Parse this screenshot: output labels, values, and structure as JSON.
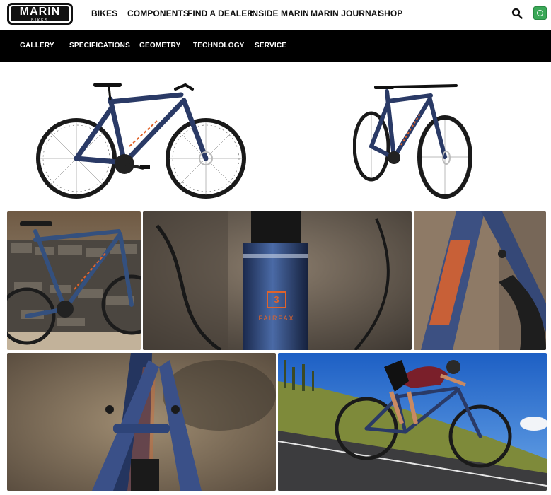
{
  "logo": {
    "word": "MARIN",
    "sub": "BIKES"
  },
  "topnav": {
    "items": [
      "BIKES",
      "COMPONENTS",
      "FIND A DEALER",
      "INSIDE MARIN",
      "MARIN JOURNAL",
      "SHOP"
    ]
  },
  "icons": {
    "search": "search-icon",
    "region": "globe-icon"
  },
  "subnav": {
    "items": [
      "GALLERY",
      "SPECIFICATIONS",
      "GEOMETRY",
      "TECHNOLOGY",
      "SERVICE"
    ]
  },
  "hero": {
    "images": [
      "bike-side-view",
      "bike-three-quarter-view"
    ]
  },
  "gallery": {
    "tiles": [
      "bike-against-stone-wall",
      "headtube-badge-closeup",
      "seat-tube-decal-closeup",
      "seatstay-bridge-closeup",
      "rider-on-road"
    ],
    "badge_number": "3",
    "badge_text": "FAIRFAX"
  },
  "colors": {
    "frame": "#2a3a66",
    "accent": "#e0632a",
    "subnav_bg": "#000000",
    "region": "#3aa857"
  }
}
